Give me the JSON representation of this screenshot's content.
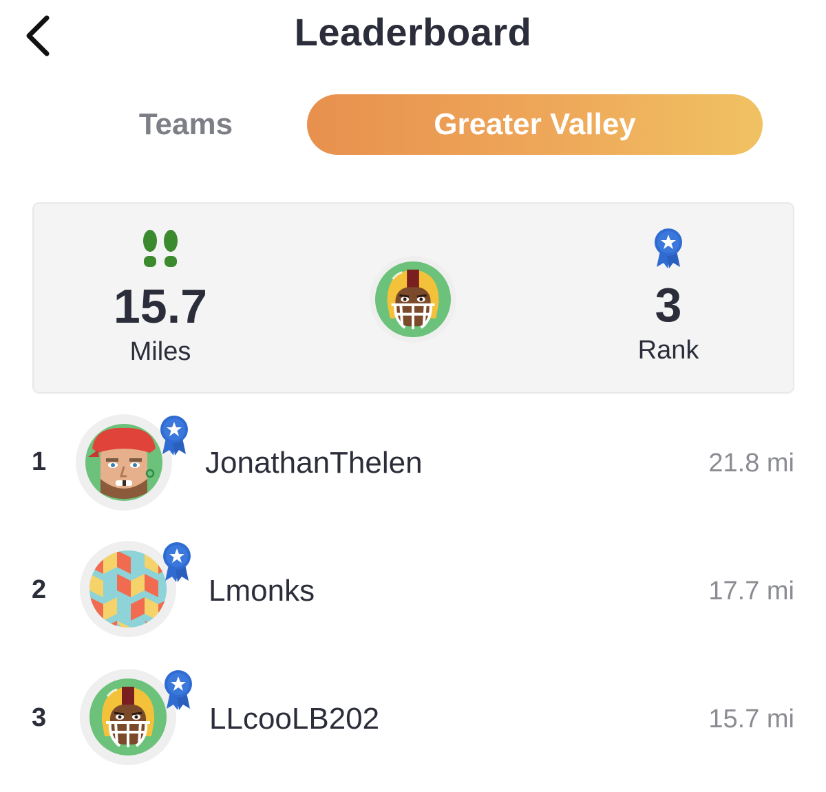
{
  "header": {
    "title": "Leaderboard",
    "back_icon": "chevron-left-icon"
  },
  "tabs": [
    {
      "label": "Teams",
      "active": false
    },
    {
      "label": "Greater Valley",
      "active": true
    }
  ],
  "colors": {
    "active_tab_gradient": [
      "#e8904e",
      "#f0c262"
    ],
    "footsteps": "#3c8a2e",
    "ribbon": "#2f6bd1",
    "text": "#2b2d3a",
    "muted": "#8a8c92"
  },
  "summary": {
    "miles_value": "15.7",
    "miles_label": "Miles",
    "miles_icon": "footsteps-icon",
    "rank_value": "3",
    "rank_label": "Rank",
    "rank_icon": "award-ribbon-icon",
    "avatar": "football-player-avatar"
  },
  "leaderboard": [
    {
      "rank": "1",
      "name": "JonathanThelen",
      "distance": "21.8 mi",
      "avatar": "pirate-avatar"
    },
    {
      "rank": "2",
      "name": "Lmonks",
      "distance": "17.7 mi",
      "avatar": "cubes-pattern-avatar"
    },
    {
      "rank": "3",
      "name": "LLcooLB202",
      "distance": "15.7 mi",
      "avatar": "football-player-avatar"
    }
  ]
}
